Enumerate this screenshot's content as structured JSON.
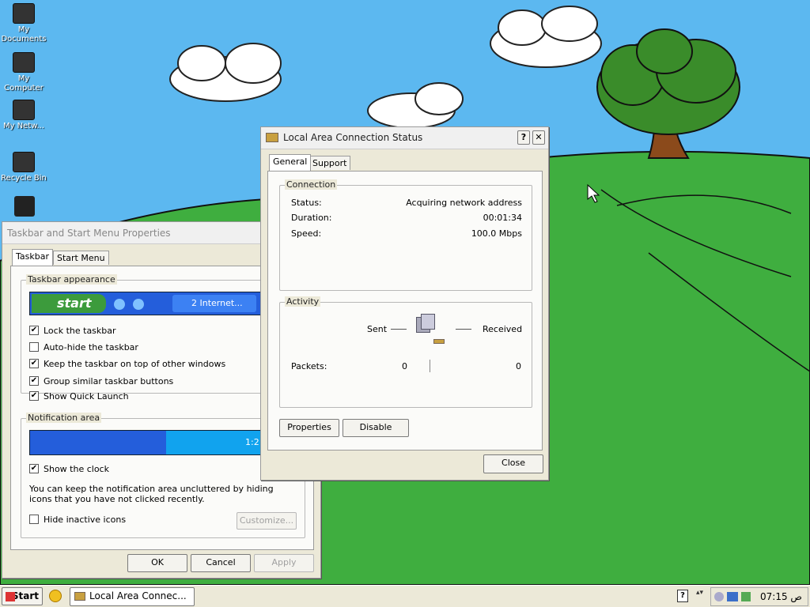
{
  "desktop": {
    "icons": [
      "My Documents",
      "My Computer",
      "My Netw...",
      "Recycle Bin"
    ]
  },
  "taskbar_props": {
    "title": "Taskbar and Start Menu Properties",
    "tabs": [
      "Taskbar",
      "Start Menu"
    ],
    "appearance_label": "Taskbar appearance",
    "preview_start": "start",
    "preview_button": "2 Internet...",
    "options": [
      {
        "label": "Lock the taskbar",
        "checked": true
      },
      {
        "label": "Auto-hide the taskbar",
        "checked": false
      },
      {
        "label": "Keep the taskbar on top of other windows",
        "checked": true
      },
      {
        "label": "Group similar taskbar buttons",
        "checked": true
      },
      {
        "label": "Show Quick Launch",
        "checked": true
      }
    ],
    "notification_label": "Notification area",
    "notification_preview_time": "1:2",
    "show_clock": "Show the clock",
    "note": "You can keep the notification area uncluttered by hiding icons that you have not clicked recently.",
    "hide_inactive": "Hide inactive icons",
    "customize": "Customize...",
    "ok": "OK",
    "cancel": "Cancel",
    "apply": "Apply"
  },
  "lan_status": {
    "title": "Local Area Connection Status",
    "help": "?",
    "close_x": "✕",
    "tabs": [
      "General",
      "Support"
    ],
    "connection_label": "Connection",
    "rows": [
      {
        "label": "Status:",
        "value": "Acquiring network address"
      },
      {
        "label": "Duration:",
        "value": "00:01:34"
      },
      {
        "label": "Speed:",
        "value": "100.0 Mbps"
      }
    ],
    "activity_label": "Activity",
    "sent_label": "Sent",
    "received_label": "Received",
    "packets_label": "Packets:",
    "packets_sent": "0",
    "packets_received": "0",
    "properties": "Properties",
    "disable": "Disable",
    "close": "Close"
  },
  "taskbar": {
    "start": "Start",
    "task_button": "Local Area Connec...",
    "time": "07:15 ص"
  }
}
